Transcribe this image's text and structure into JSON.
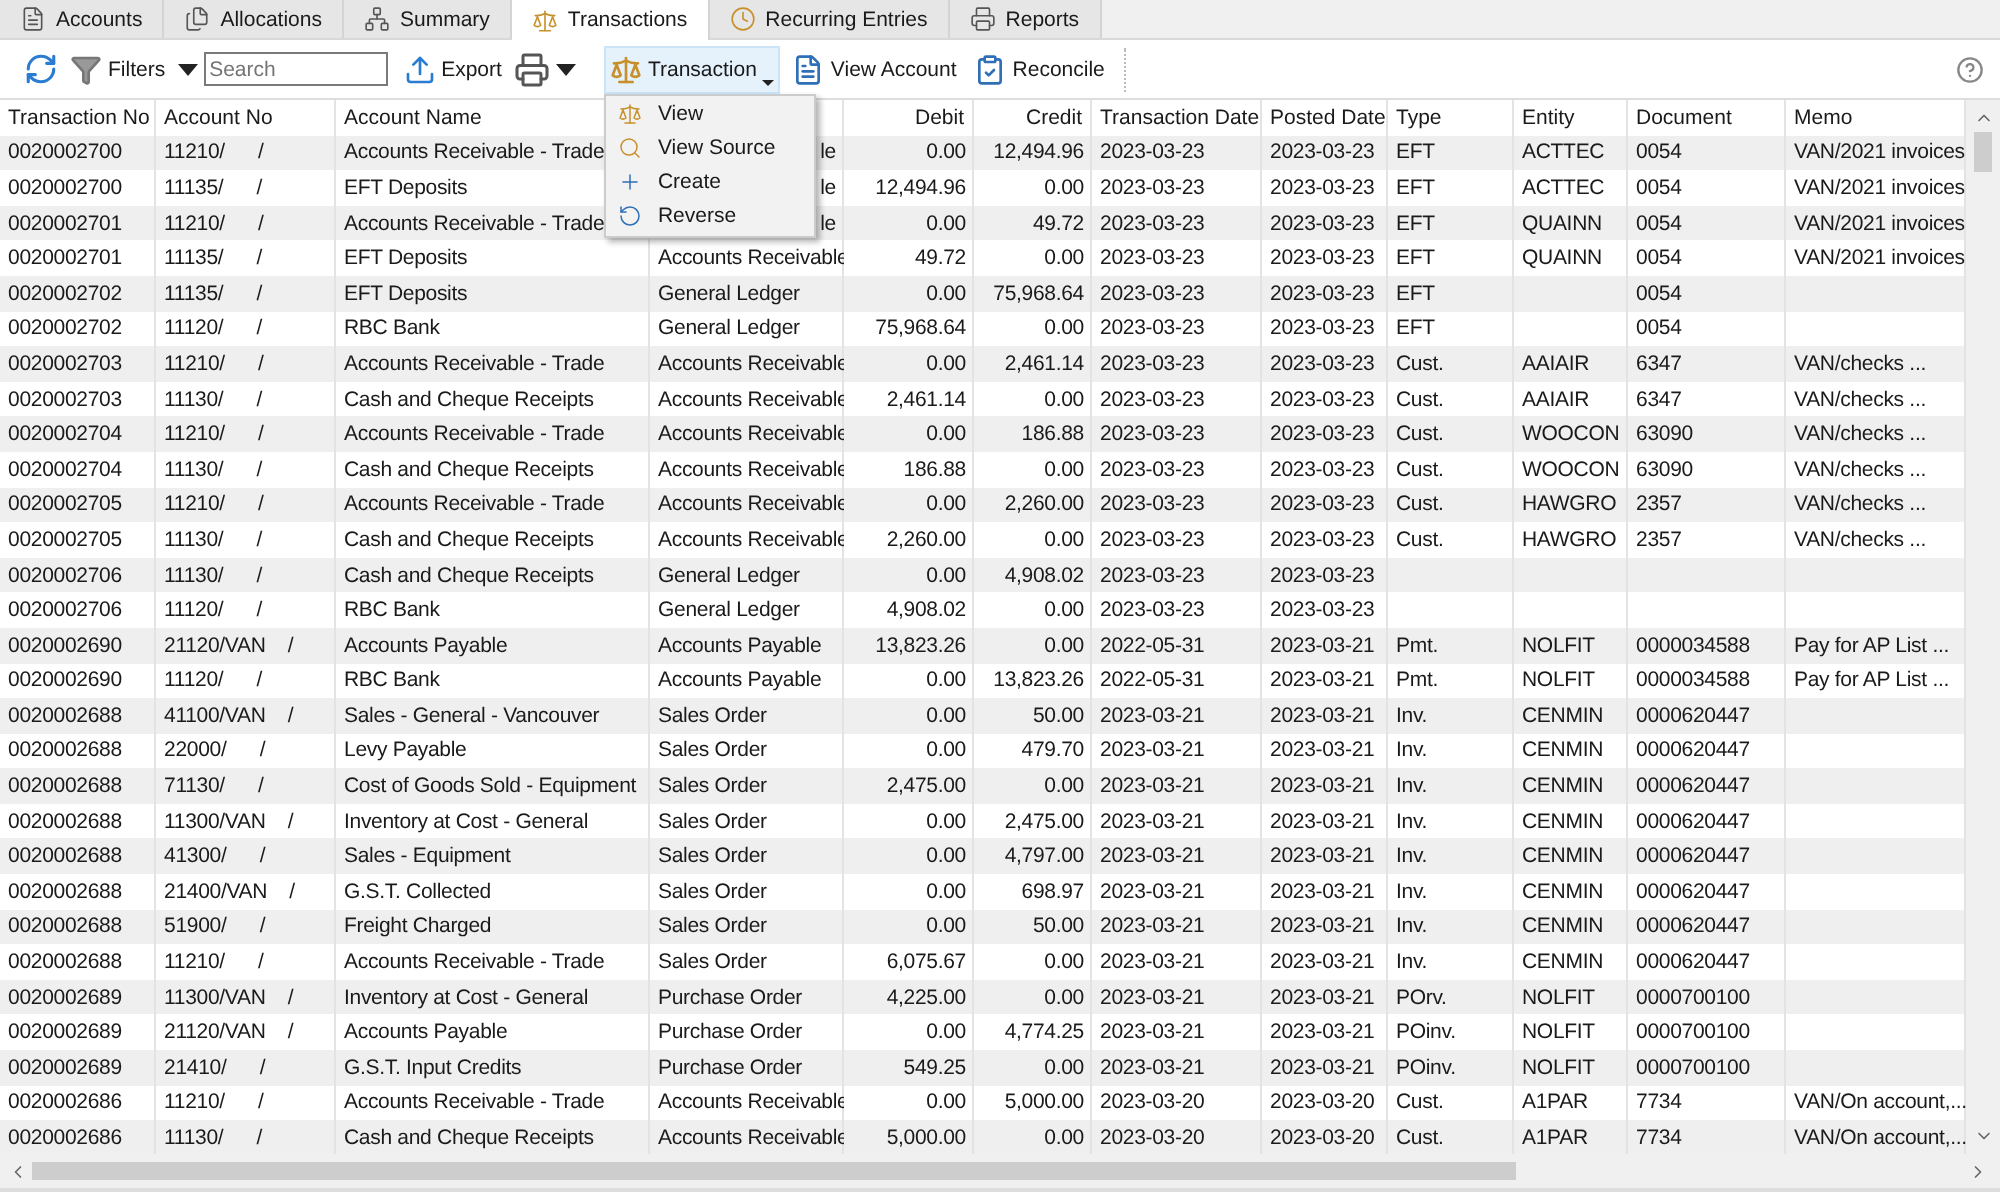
{
  "tabs": [
    {
      "label": "Accounts",
      "selected": false
    },
    {
      "label": "Allocations",
      "selected": false
    },
    {
      "label": "Summary",
      "selected": false
    },
    {
      "label": "Transactions",
      "selected": true
    },
    {
      "label": "Recurring Entries",
      "selected": false
    },
    {
      "label": "Reports",
      "selected": false
    }
  ],
  "toolbar": {
    "filters_label": "Filters",
    "search": {
      "placeholder": "Search"
    },
    "export_label": "Export",
    "transaction": {
      "label": "Transaction",
      "expanded": true
    },
    "view_account_label": "View Account",
    "reconcile_label": "Reconcile"
  },
  "transaction_menu": [
    {
      "label": "View"
    },
    {
      "label": "View Source"
    },
    {
      "label": "Create"
    },
    {
      "label": "Reverse"
    }
  ],
  "table": {
    "columns": [
      {
        "label": "Transaction No"
      },
      {
        "label": "Account No"
      },
      {
        "label": "Account Name"
      },
      {},
      {
        "label": "Debit"
      },
      {
        "label": "Credit"
      },
      {
        "label": "Transaction Date"
      },
      {
        "label": "Posted Date"
      },
      {
        "label": "Type"
      },
      {
        "label": "Entity"
      },
      {
        "label": "Document"
      },
      {
        "label": "Memo"
      }
    ],
    "rows": [
      [
        "0020002700",
        "11210/      /",
        "Accounts Receivable - Trade",
        "le",
        "0.00",
        "12,494.96",
        "2023-03-23",
        "2023-03-23",
        "EFT",
        "ACTTEC",
        "0054",
        "VAN/2021 invoices"
      ],
      [
        "0020002700",
        "11135/      /",
        "EFT Deposits",
        "le",
        "12,494.96",
        "0.00",
        "2023-03-23",
        "2023-03-23",
        "EFT",
        "ACTTEC",
        "0054",
        "VAN/2021 invoices"
      ],
      [
        "0020002701",
        "11210/      /",
        "Accounts Receivable - Trade",
        "le",
        "0.00",
        "49.72",
        "2023-03-23",
        "2023-03-23",
        "EFT",
        "QUAINN",
        "0054",
        "VAN/2021 invoices"
      ],
      [
        "0020002701",
        "11135/      /",
        "EFT Deposits",
        "Accounts Receivable",
        "49.72",
        "0.00",
        "2023-03-23",
        "2023-03-23",
        "EFT",
        "QUAINN",
        "0054",
        "VAN/2021 invoices"
      ],
      [
        "0020002702",
        "11135/      /",
        "EFT Deposits",
        "General Ledger",
        "0.00",
        "75,968.64",
        "2023-03-23",
        "2023-03-23",
        "EFT",
        null,
        "0054",
        null
      ],
      [
        "0020002702",
        "11120/      /",
        "RBC Bank",
        "General Ledger",
        "75,968.64",
        "0.00",
        "2023-03-23",
        "2023-03-23",
        "EFT",
        null,
        "0054",
        null
      ],
      [
        "0020002703",
        "11210/      /",
        "Accounts Receivable - Trade",
        "Accounts Receivable",
        "0.00",
        "2,461.14",
        "2023-03-23",
        "2023-03-23",
        "Cust.",
        "AAIAIR",
        "6347",
        "VAN/checks ..."
      ],
      [
        "0020002703",
        "11130/      /",
        "Cash and Cheque Receipts",
        "Accounts Receivable",
        "2,461.14",
        "0.00",
        "2023-03-23",
        "2023-03-23",
        "Cust.",
        "AAIAIR",
        "6347",
        "VAN/checks ..."
      ],
      [
        "0020002704",
        "11210/      /",
        "Accounts Receivable - Trade",
        "Accounts Receivable",
        "0.00",
        "186.88",
        "2023-03-23",
        "2023-03-23",
        "Cust.",
        "WOOCON",
        "63090",
        "VAN/checks ..."
      ],
      [
        "0020002704",
        "11130/      /",
        "Cash and Cheque Receipts",
        "Accounts Receivable",
        "186.88",
        "0.00",
        "2023-03-23",
        "2023-03-23",
        "Cust.",
        "WOOCON",
        "63090",
        "VAN/checks ..."
      ],
      [
        "0020002705",
        "11210/      /",
        "Accounts Receivable - Trade",
        "Accounts Receivable",
        "0.00",
        "2,260.00",
        "2023-03-23",
        "2023-03-23",
        "Cust.",
        "HAWGRO",
        "2357",
        "VAN/checks ..."
      ],
      [
        "0020002705",
        "11130/      /",
        "Cash and Cheque Receipts",
        "Accounts Receivable",
        "2,260.00",
        "0.00",
        "2023-03-23",
        "2023-03-23",
        "Cust.",
        "HAWGRO",
        "2357",
        "VAN/checks ..."
      ],
      [
        "0020002706",
        "11130/      /",
        "Cash and Cheque Receipts",
        "General Ledger",
        "0.00",
        "4,908.02",
        "2023-03-23",
        "2023-03-23",
        null,
        null,
        null,
        null
      ],
      [
        "0020002706",
        "11120/      /",
        "RBC Bank",
        "General Ledger",
        "4,908.02",
        "0.00",
        "2023-03-23",
        "2023-03-23",
        null,
        null,
        null,
        null
      ],
      [
        "0020002690",
        "21120/VAN    /",
        "Accounts Payable",
        "Accounts Payable",
        "13,823.26",
        "0.00",
        "2022-05-31",
        "2023-03-21",
        "Pmt.",
        "NOLFIT",
        "0000034588",
        "Pay for AP List ..."
      ],
      [
        "0020002690",
        "11120/      /",
        "RBC Bank",
        "Accounts Payable",
        "0.00",
        "13,823.26",
        "2022-05-31",
        "2023-03-21",
        "Pmt.",
        "NOLFIT",
        "0000034588",
        "Pay for AP List ..."
      ],
      [
        "0020002688",
        "41100/VAN    /",
        "Sales - General - Vancouver",
        "Sales Order",
        "0.00",
        "50.00",
        "2023-03-21",
        "2023-03-21",
        "Inv.",
        "CENMIN",
        "0000620447",
        null
      ],
      [
        "0020002688",
        "22000/      /",
        "Levy Payable",
        "Sales Order",
        "0.00",
        "479.70",
        "2023-03-21",
        "2023-03-21",
        "Inv.",
        "CENMIN",
        "0000620447",
        null
      ],
      [
        "0020002688",
        "71130/      /",
        "Cost of Goods Sold - Equipment",
        "Sales Order",
        "2,475.00",
        "0.00",
        "2023-03-21",
        "2023-03-21",
        "Inv.",
        "CENMIN",
        "0000620447",
        null
      ],
      [
        "0020002688",
        "11300/VAN    /",
        "Inventory at Cost - General",
        "Sales Order",
        "0.00",
        "2,475.00",
        "2023-03-21",
        "2023-03-21",
        "Inv.",
        "CENMIN",
        "0000620447",
        null
      ],
      [
        "0020002688",
        "41300/      /",
        "Sales - Equipment",
        "Sales Order",
        "0.00",
        "4,797.00",
        "2023-03-21",
        "2023-03-21",
        "Inv.",
        "CENMIN",
        "0000620447",
        null
      ],
      [
        "0020002688",
        "21400/VAN    /",
        "G.S.T. Collected",
        "Sales Order",
        "0.00",
        "698.97",
        "2023-03-21",
        "2023-03-21",
        "Inv.",
        "CENMIN",
        "0000620447",
        null
      ],
      [
        "0020002688",
        "51900/      /",
        "Freight Charged",
        "Sales Order",
        "0.00",
        "50.00",
        "2023-03-21",
        "2023-03-21",
        "Inv.",
        "CENMIN",
        "0000620447",
        null
      ],
      [
        "0020002688",
        "11210/      /",
        "Accounts Receivable - Trade",
        "Sales Order",
        "6,075.67",
        "0.00",
        "2023-03-21",
        "2023-03-21",
        "Inv.",
        "CENMIN",
        "0000620447",
        null
      ],
      [
        "0020002689",
        "11300/VAN    /",
        "Inventory at Cost - General",
        "Purchase Order",
        "4,225.00",
        "0.00",
        "2023-03-21",
        "2023-03-21",
        "POrv.",
        "NOLFIT",
        "0000700100",
        null
      ],
      [
        "0020002689",
        "21120/VAN    /",
        "Accounts Payable",
        "Purchase Order",
        "0.00",
        "4,774.25",
        "2023-03-21",
        "2023-03-21",
        "POinv.",
        "NOLFIT",
        "0000700100",
        null
      ],
      [
        "0020002689",
        "21410/      /",
        "G.S.T. Input Credits",
        "Purchase Order",
        "549.25",
        "0.00",
        "2023-03-21",
        "2023-03-21",
        "POinv.",
        "NOLFIT",
        "0000700100",
        null
      ],
      [
        "0020002686",
        "11210/      /",
        "Accounts Receivable - Trade",
        "Accounts Receivable",
        "0.00",
        "5,000.00",
        "2023-03-20",
        "2023-03-20",
        "Cust.",
        "A1PAR",
        "7734",
        "VAN/On account,..."
      ],
      [
        "0020002686",
        "11130/      /",
        "Cash and Cheque Receipts",
        "Accounts Receivable",
        "5,000.00",
        "0.00",
        "2023-03-20",
        "2023-03-20",
        "Cust.",
        "A1PAR",
        "7734",
        "VAN/On account,..."
      ]
    ]
  }
}
